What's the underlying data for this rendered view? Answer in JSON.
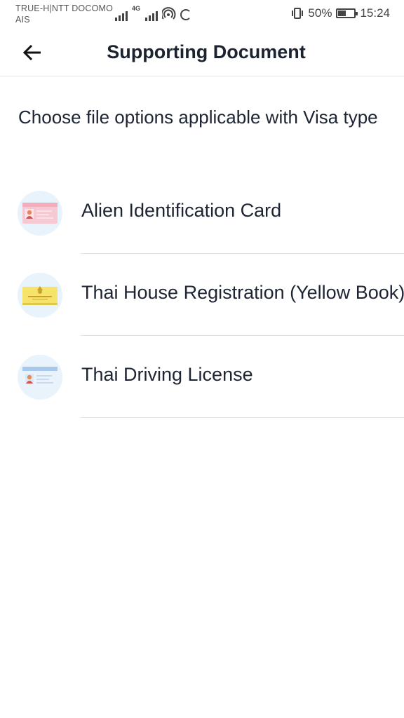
{
  "status_bar": {
    "carrier_line1": "TRUE-H|NTT DOCOMO",
    "carrier_line2": "AIS",
    "network_tag": "4G",
    "battery_percent": "50%",
    "battery_level": 0.5,
    "time": "15:24"
  },
  "header": {
    "title": "Supporting Document",
    "back_icon": "arrow-left-icon"
  },
  "intro": "Choose file options applicable with Visa type",
  "documents": [
    {
      "label": "Alien Identification Card",
      "icon": "alien-id-card-icon",
      "card_color": "#f7c9d3"
    },
    {
      "label": "Thai House Registration (Yellow Book)",
      "icon": "house-registration-book-icon",
      "card_color": "#f5e36b"
    },
    {
      "label": "Thai Driving License",
      "icon": "driving-license-icon",
      "card_color": "#cfe0f5"
    }
  ],
  "colors": {
    "icon_circle_bg": "#e8f3fb",
    "text": "#1d2433",
    "divider": "#e2e2e2"
  }
}
